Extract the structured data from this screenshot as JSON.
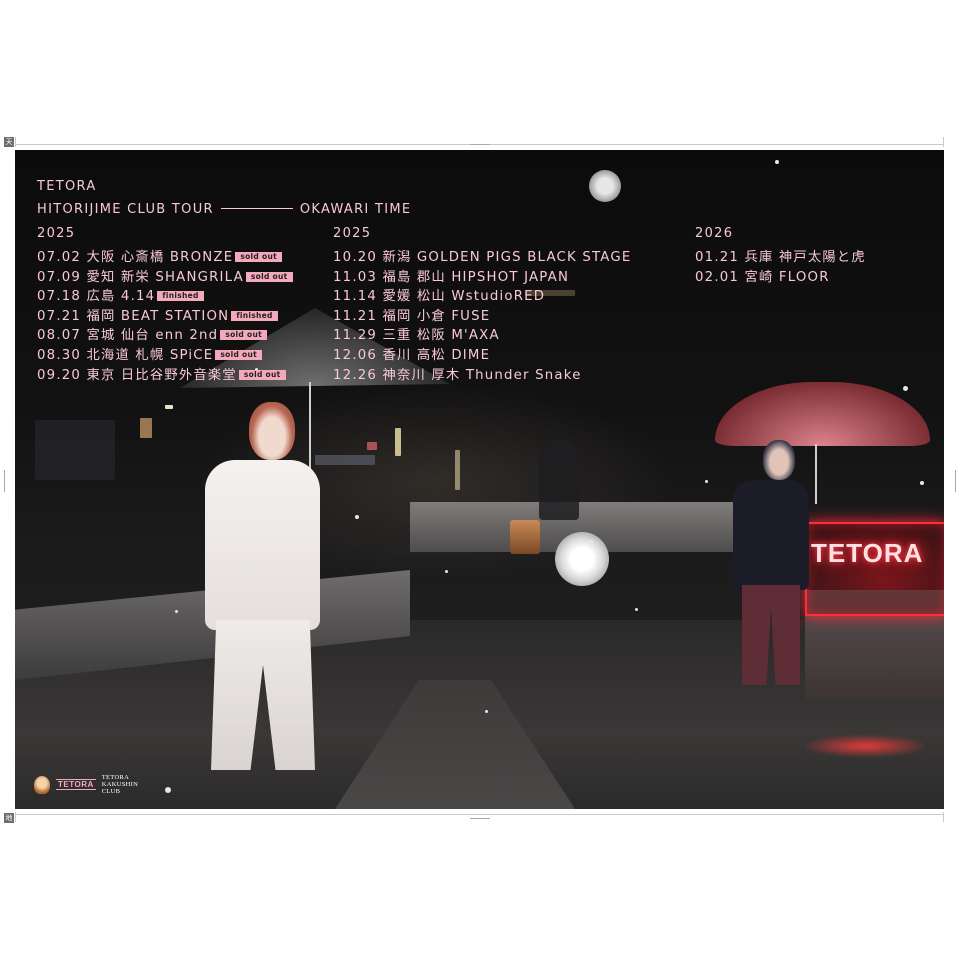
{
  "print_marks": {
    "top_label": "天",
    "bottom_label": "地"
  },
  "poster": {
    "band": "TETORA",
    "tour_name": "HITORIJIME CLUB TOUR",
    "tour_subtitle": "OKAWARI TIME",
    "neon_sign": "TETORA",
    "columns": [
      {
        "year": "2025",
        "dates": [
          {
            "text": "07.02 大阪 心斎橋 BRONZE",
            "badge": "sold out"
          },
          {
            "text": "07.09 愛知 新栄 SHANGRILA",
            "badge": "sold out"
          },
          {
            "text": "07.18 広島 4.14",
            "badge": "finished"
          },
          {
            "text": "07.21 福岡 BEAT STATION",
            "badge": "finished"
          },
          {
            "text": "08.07 宮城 仙台 enn 2nd",
            "badge": "sold out"
          },
          {
            "text": "08.30 北海道 札幌 SPiCE",
            "badge": "sold out"
          },
          {
            "text": "09.20 東京 日比谷野外音楽堂",
            "badge": "sold out"
          }
        ]
      },
      {
        "year": "2025",
        "dates": [
          {
            "text": "10.20 新潟 GOLDEN PIGS BLACK STAGE",
            "badge": ""
          },
          {
            "text": "11.03 福島 郡山 HIPSHOT JAPAN",
            "badge": ""
          },
          {
            "text": "11.14 愛媛 松山 WstudioRED",
            "badge": ""
          },
          {
            "text": "11.21 福岡 小倉 FUSE",
            "badge": ""
          },
          {
            "text": "11.29 三重 松阪 M'AXA",
            "badge": ""
          },
          {
            "text": "12.06 香川 高松 DIME",
            "badge": ""
          },
          {
            "text": "12.26 神奈川 厚木 Thunder Snake",
            "badge": ""
          }
        ]
      },
      {
        "year": "2026",
        "dates": [
          {
            "text": "01.21 兵庫 神戸太陽と虎",
            "badge": ""
          },
          {
            "text": "02.01 宮崎 FLOOR",
            "badge": ""
          }
        ]
      }
    ],
    "footer": {
      "logo_text": "TETORA",
      "club_line1": "TETORA",
      "club_line2": "KAKUSHIN",
      "club_line3": "CLUB"
    }
  },
  "colors": {
    "text_pink": "#f7c9d2",
    "badge_pink": "#f3a9bb",
    "neon_red": "#ff2d3a",
    "background_night": "#121112"
  },
  "icons": [
    "mascot-icon"
  ]
}
